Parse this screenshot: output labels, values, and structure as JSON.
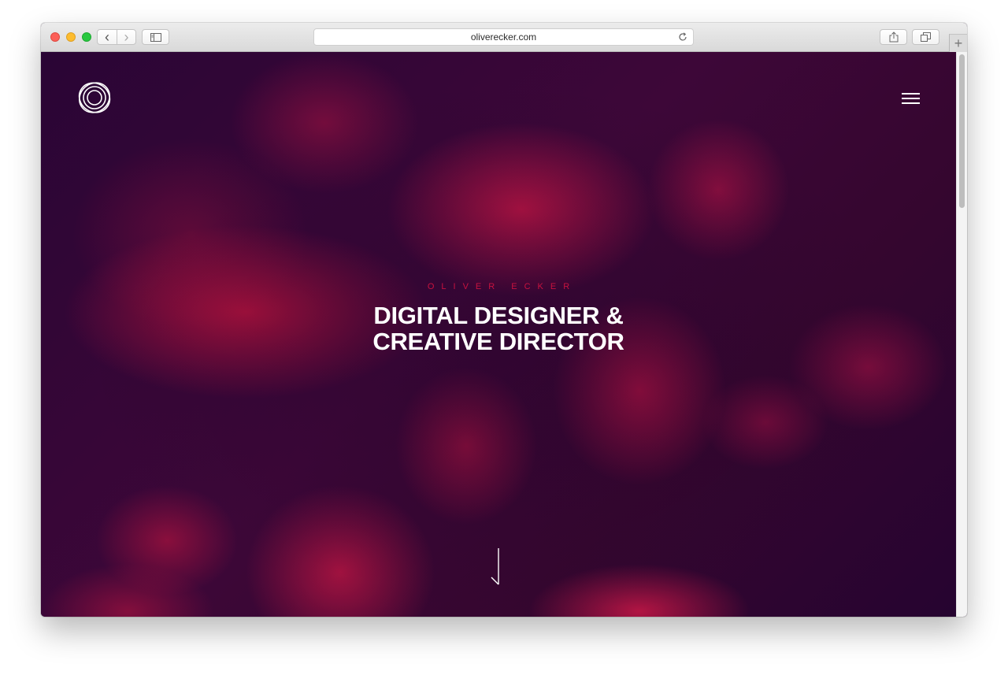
{
  "browser": {
    "url": "oliverecker.com",
    "nav_back_glyph": "‹",
    "nav_forward_glyph": "›",
    "new_tab_glyph": "+"
  },
  "site": {
    "eyebrow": "OLIVER ECKER",
    "headline_line1": "DIGITAL DESIGNER &",
    "headline_line2": "CREATIVE DIRECTOR"
  },
  "colors": {
    "accent": "#c8123f",
    "background": "#2a0533",
    "text": "#ffffff"
  },
  "icons": [
    "logo-rings-icon",
    "hamburger-menu-icon",
    "scroll-down-arrow-icon",
    "sidebar-icon",
    "share-icon",
    "tabs-icon",
    "reload-icon"
  ]
}
